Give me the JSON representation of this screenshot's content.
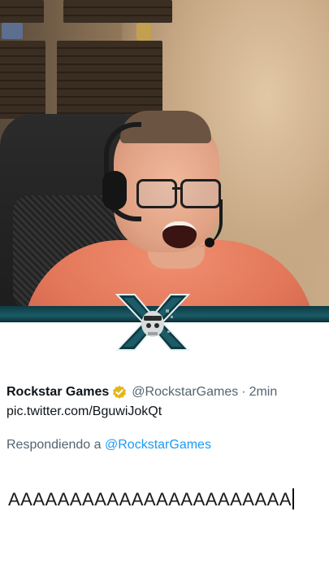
{
  "tweet": {
    "author_name": "Rockstar Games",
    "verified_icon": "gold-verified-badge-icon",
    "handle": "@RockstarGames",
    "separator": "·",
    "time": "2min",
    "link": "pic.twitter.com/BguwiJokQt",
    "reply_prefix": "Respondiendo a",
    "reply_handle": "@RockstarGames",
    "body": "AAAAAAAAAAAAAAAAAAAAAAA"
  },
  "logo": {
    "icon": "x-skull-channel-logo-icon"
  },
  "colors": {
    "accent_link": "#1d9bf0",
    "secondary_text": "#536471",
    "verified_gold": "#e2b719",
    "logo_teal": "#0f3a44"
  }
}
